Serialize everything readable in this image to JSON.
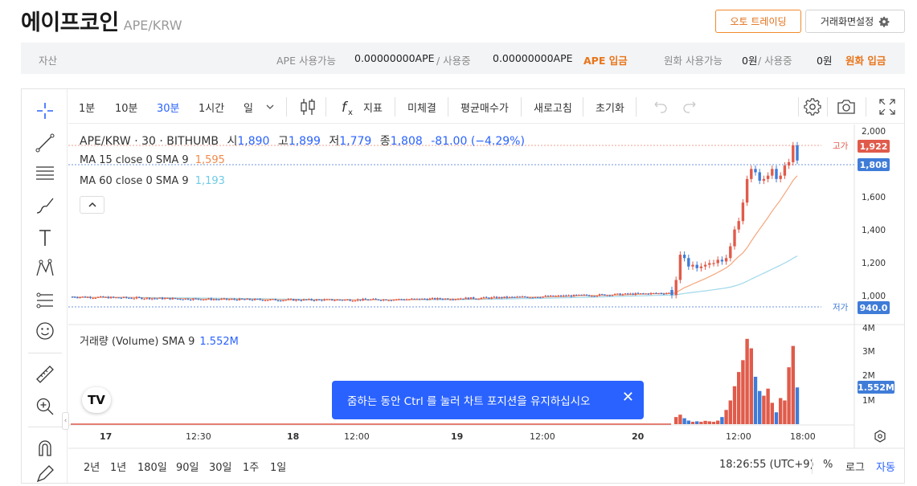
{
  "header": {
    "coin_name": "에이프코인",
    "pair": "APE/KRW",
    "auto_trading_label": "오토 트레이딩",
    "screen_settings_label": "거래화면설정"
  },
  "asset_bar": {
    "asset_label": "자산",
    "ape_available_label": "APE 사용가능",
    "ape_available_value": "0.00000000APE",
    "in_use_label": "/ 사용중",
    "ape_in_use_value": "0.00000000APE",
    "ape_deposit_link": "APE 입금",
    "krw_available_label": "원화 사용가능",
    "krw_available_value": "0원",
    "krw_in_use_label": "/ 사용중",
    "krw_in_use_value": "0원",
    "krw_deposit_link": "원화 입금"
  },
  "toolbar": {
    "intervals": [
      "1분",
      "10분",
      "30분",
      "1시간",
      "일"
    ],
    "active_interval": "30분",
    "indicators_label": "지표",
    "tick_label": "미체결",
    "avg_price_label": "평균매수가",
    "refresh_label": "새로고침",
    "reset_label": "초기화"
  },
  "legend": {
    "symbol": "APE/KRW · 30 · BITHUMB",
    "open_label": "시",
    "open": "1,890",
    "high_label": "고",
    "high": "1,899",
    "low_label": "저",
    "low": "1,779",
    "close_label": "종",
    "close": "1,808",
    "change": "-81.00 (−4.29%)",
    "ma15_label": "MA 15 close 0 SMA 9",
    "ma15_value": "1,595",
    "ma60_label": "MA 60 close 0 SMA 9",
    "ma60_value": "1,193",
    "volume_label": "거래량 (Volume) SMA 9",
    "volume_value": "1.552M"
  },
  "price_axis": {
    "ticks": [
      "2,000",
      "1,800",
      "1,600",
      "1,400",
      "1,200",
      "1,000"
    ],
    "high_label": "고가",
    "high_value": "1,922",
    "current_value": "1,808",
    "low_label": "저가",
    "low_value": "940.0"
  },
  "volume_axis": {
    "ticks": [
      "4M",
      "3M",
      "2M",
      "1M"
    ],
    "current_value": "1.552M"
  },
  "time_axis": {
    "labels": [
      "17",
      "12:30",
      "18",
      "12:00",
      "19",
      "12:00",
      "20",
      "12:00",
      "18:00"
    ],
    "bold": [
      true,
      false,
      true,
      false,
      true,
      false,
      true,
      false,
      false
    ]
  },
  "tooltip": {
    "text": "줌하는 동안 Ctrl 를 눌러 차트 포지션을 유지하십시오"
  },
  "bottom_bar": {
    "ranges": [
      "2년",
      "1년",
      "180일",
      "90일",
      "30일",
      "1주",
      "1일"
    ],
    "clock": "18:26:55 (UTC+9)",
    "percent_label": "%",
    "log_label": "로그",
    "auto_label": "자동"
  },
  "colors": {
    "up": "#e05b4b",
    "down": "#3f7cd8",
    "accent": "#2962ff",
    "orange": "#e8751a",
    "ma15": "#f5a67c",
    "ma60": "#9fd8ea"
  },
  "chart_data": {
    "type": "line",
    "series": [
      {
        "name": "APE/KRW",
        "x": [
          "17",
          "12:30",
          "18",
          "12:00",
          "19",
          "12:00",
          "20",
          "12:00",
          "18:00"
        ],
        "values": [
          1000,
          985,
          960,
          1000,
          990,
          1020,
          1010,
          1120,
          1808
        ]
      }
    ],
    "ylim": [
      940,
      2000
    ],
    "volume_max": "4M"
  }
}
